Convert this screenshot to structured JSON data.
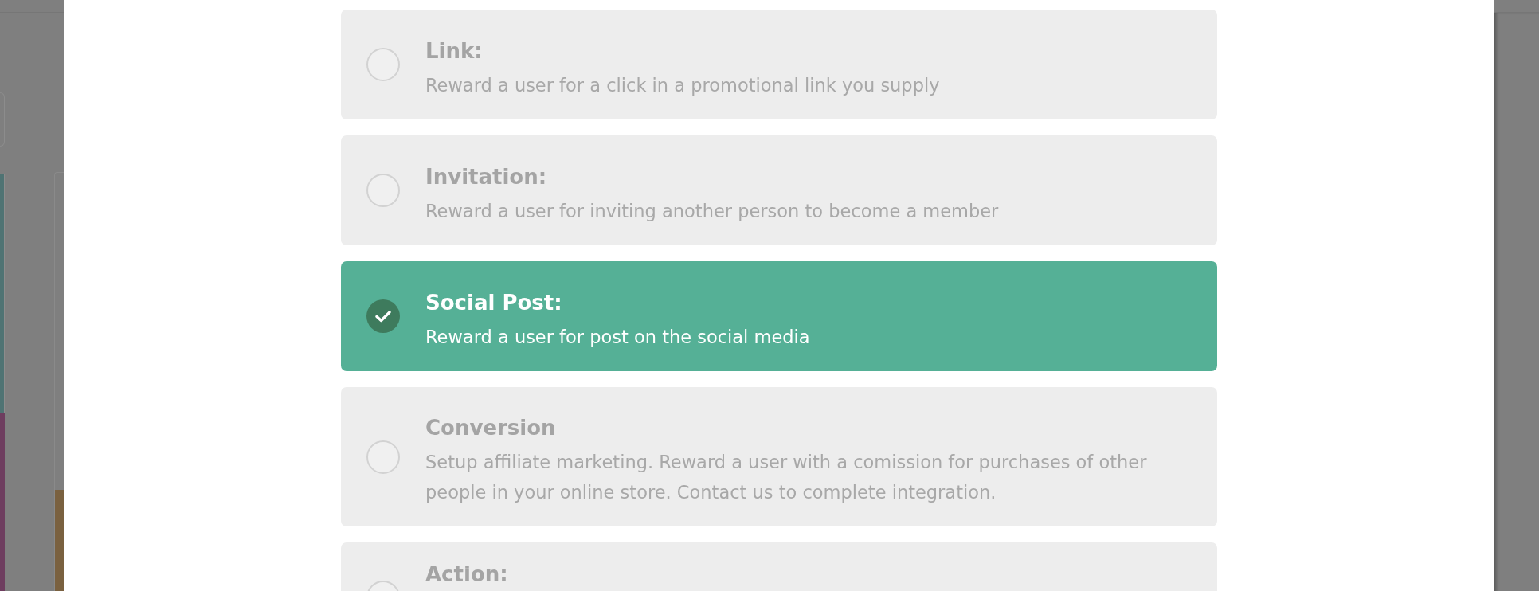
{
  "options": [
    {
      "title": "Link:",
      "description": "Reward a user for a click in a promotional link you supply",
      "selected": false
    },
    {
      "title": "Invitation:",
      "description": "Reward a user for inviting another person to become a member",
      "selected": false
    },
    {
      "title": "Social Post:",
      "description": "Reward a user for post on the social media",
      "selected": true
    },
    {
      "title": "Conversion",
      "description": "Setup affiliate marketing. Reward a user with a comission for purchases of other people in your online store. Contact us to complete integration.",
      "selected": false
    },
    {
      "title": "Action:",
      "selected": false
    }
  ]
}
